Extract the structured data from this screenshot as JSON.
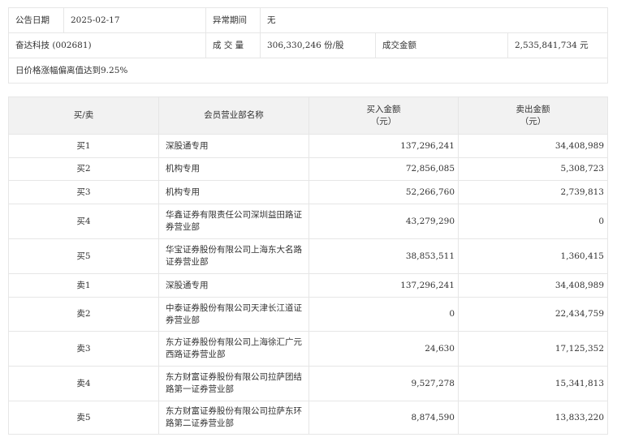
{
  "info": {
    "date_label": "公告日期",
    "date": "2025-02-17",
    "period_label": "异常期间",
    "period": "无",
    "stock": "奋达科技 (002681)",
    "volume_label": "成 交 量",
    "volume": "306,330,246 份/股",
    "amount_label": "成交金额",
    "amount": "2,535,841,734 元",
    "reason": "日价格涨幅偏离值达到9.25%"
  },
  "table": {
    "headers": [
      "买/卖",
      "会员营业部名称",
      "买入金额\n（元）",
      "卖出金额\n（元）"
    ],
    "rows": [
      {
        "side": "买1",
        "name": "深股通专用",
        "buy": "137,296,241",
        "sell": "34,408,989"
      },
      {
        "side": "买2",
        "name": "机构专用",
        "buy": "72,856,085",
        "sell": "5,308,723"
      },
      {
        "side": "买3",
        "name": "机构专用",
        "buy": "52,266,760",
        "sell": "2,739,813"
      },
      {
        "side": "买4",
        "name": "华鑫证券有限责任公司深圳益田路证券营业部",
        "buy": "43,279,290",
        "sell": "0"
      },
      {
        "side": "买5",
        "name": "华宝证券股份有限公司上海东大名路证券营业部",
        "buy": "38,853,511",
        "sell": "1,360,415"
      },
      {
        "side": "卖1",
        "name": "深股通专用",
        "buy": "137,296,241",
        "sell": "34,408,989"
      },
      {
        "side": "卖2",
        "name": "中泰证券股份有限公司天津长江道证券营业部",
        "buy": "0",
        "sell": "22,434,759"
      },
      {
        "side": "卖3",
        "name": "东方证券股份有限公司上海徐汇广元西路证券营业部",
        "buy": "24,630",
        "sell": "17,125,352"
      },
      {
        "side": "卖4",
        "name": "东方财富证券股份有限公司拉萨团结路第一证券营业部",
        "buy": "9,527,278",
        "sell": "15,341,813"
      },
      {
        "side": "卖5",
        "name": "东方财富证券股份有限公司拉萨东环路第二证券营业部",
        "buy": "8,874,590",
        "sell": "13,833,220"
      }
    ]
  }
}
